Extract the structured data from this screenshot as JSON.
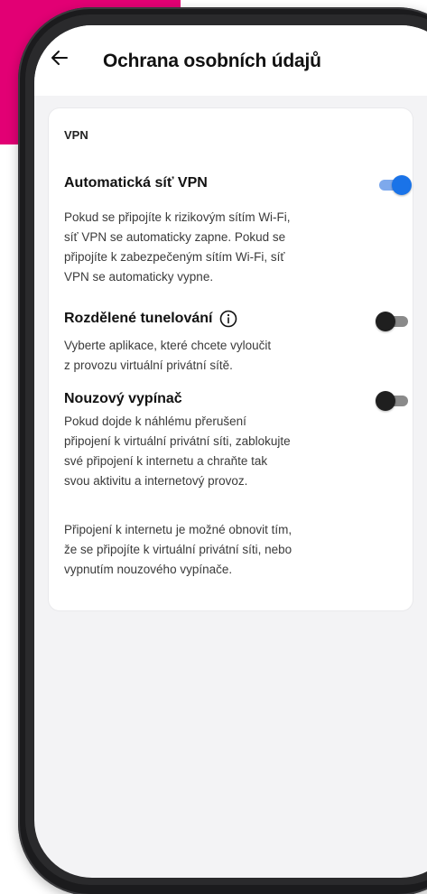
{
  "header": {
    "title": "Ochrana osobních údajů",
    "back_icon": "arrow-left-icon"
  },
  "vpn": {
    "section_label": "VPN",
    "auto_vpn": {
      "title": "Automatická síť VPN",
      "desc_lines": [
        "Pokud se připojíte k rizikovým sítím Wi-Fi,",
        "síť VPN se automaticky zapne. Pokud se",
        "připojíte k zabezpečeným sítím Wi-Fi, síť",
        "VPN se automaticky vypne."
      ],
      "enabled": true
    },
    "split_tunnel": {
      "title": "Rozdělené tunelování",
      "info_icon": "info-icon",
      "desc_lines": [
        "Vyberte aplikace, které chcete vyloučit",
        "z provozu virtuální privátní sítě."
      ],
      "enabled": false
    },
    "kill_switch": {
      "title": "Nouzový vypínač",
      "desc_lines": [
        "Pokud dojde k náhlému přerušení",
        "připojení k virtuální privátní síti, zablokujte",
        "své připojení k internetu a chraňte tak",
        "svou aktivitu a internetový provoz."
      ],
      "note_lines": [
        "Připojení k internetu je možné obnovit tím,",
        "že se připojíte k virtuální privátní síti, nebo",
        "vypnutím nouzového vypínače."
      ],
      "enabled": false
    }
  },
  "colors": {
    "brand_magenta": "#e20074",
    "toggle_on": "#1a73e8",
    "toggle_off": "#1f1f1f"
  }
}
